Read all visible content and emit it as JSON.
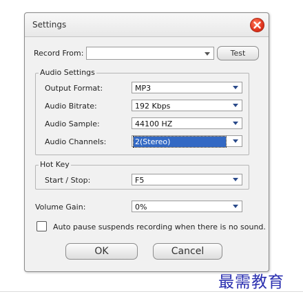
{
  "dialog": {
    "title": "Settings",
    "close_icon": "close-icon"
  },
  "record_from": {
    "label": "Record  From:",
    "value": "",
    "test_label": "Test"
  },
  "audio_settings": {
    "group_label": "Audio Settings",
    "fields": [
      {
        "label": "Output Format:",
        "value": "MP3"
      },
      {
        "label": "Audio Bitrate:",
        "value": "192 Kbps"
      },
      {
        "label": "Audio Sample:",
        "value": "44100 HZ"
      },
      {
        "label": "Audio Channels:",
        "value": "2(Stereo)"
      }
    ]
  },
  "hot_key": {
    "group_label": "Hot Key",
    "label": "Start / Stop:",
    "value": "F5"
  },
  "volume_gain": {
    "label": "Volume Gain:",
    "value": "0%"
  },
  "auto_pause": {
    "label": "Auto pause suspends recording when there is no sound.",
    "checked": false
  },
  "buttons": {
    "ok": "OK",
    "cancel": "Cancel"
  },
  "watermark": "最需教育",
  "colors": {
    "close": "#e0341d",
    "selection": "#3369c4",
    "arrow": "#2a4a8a"
  }
}
